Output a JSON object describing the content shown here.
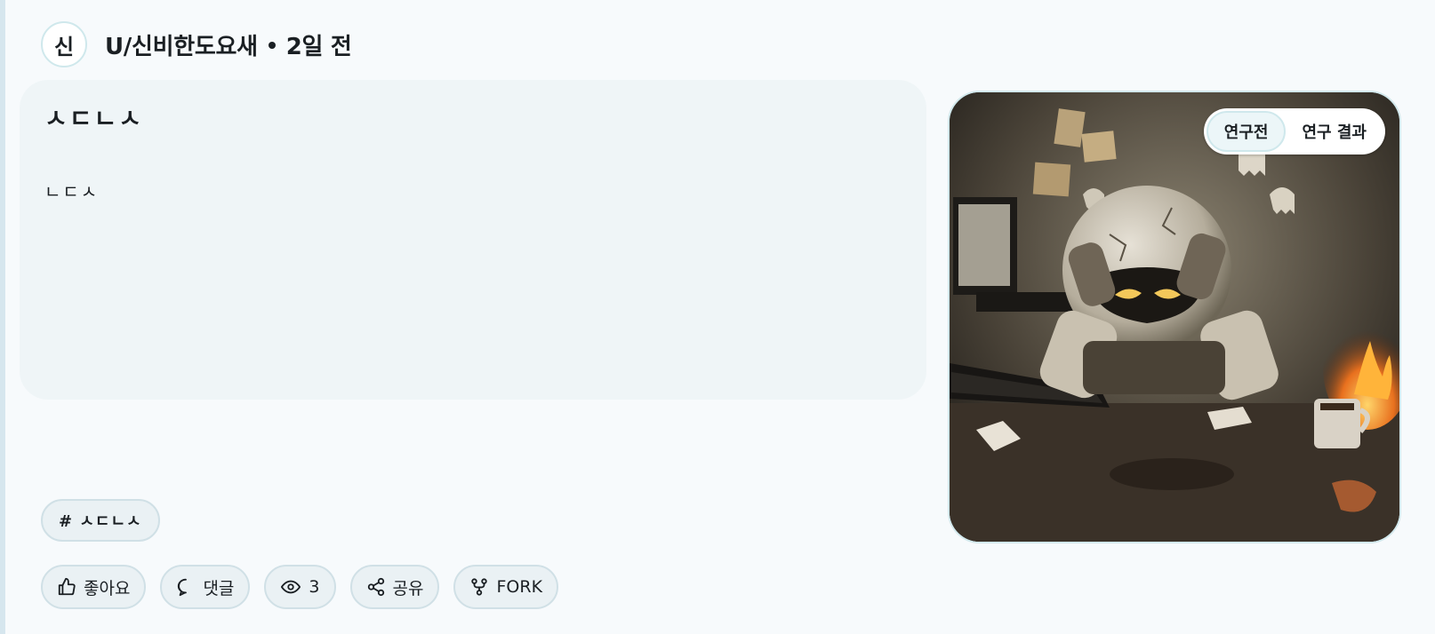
{
  "header": {
    "avatar_initial": "신",
    "username": "U/신비한도요새",
    "time_ago": "2일 전"
  },
  "post": {
    "title": "ㅅㄷㄴㅅ",
    "body": "ㄴㄷㅅ"
  },
  "image_toggle": {
    "options": [
      "연구전",
      "연구 결과"
    ],
    "selected": "연구전"
  },
  "tags": [
    "# ㅅㄷㄴㅅ"
  ],
  "actions": {
    "like_label": "좋아요",
    "comment_label": "댓글",
    "views_count": "3",
    "share_label": "공유",
    "fork_label": "FORK"
  },
  "icons": {
    "like": "thumbs-up-icon",
    "comment": "speech-bubble-icon",
    "views": "eye-icon",
    "share": "share-icon",
    "fork": "fork-icon"
  }
}
